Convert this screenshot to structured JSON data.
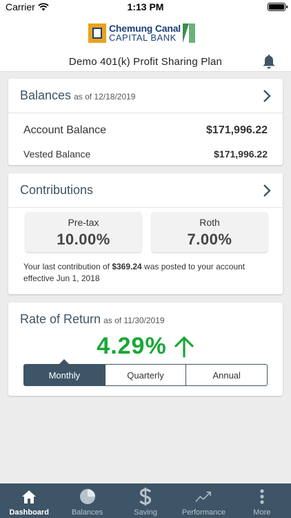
{
  "status": {
    "carrier": "Carrier",
    "time": "1:13 PM"
  },
  "header": {
    "logo_line1": "Chemung Canal",
    "logo_line2": "CAPITAL BANK",
    "plan_title": "Demo 401(k) Profit Sharing Plan"
  },
  "balances": {
    "title": "Balances",
    "as_of": "as of 12/18/2019",
    "account_label": "Account Balance",
    "account_value": "$171,996.22",
    "vested_label": "Vested Balance",
    "vested_value": "$171,996.22"
  },
  "contributions": {
    "title": "Contributions",
    "pretax_label": "Pre-tax",
    "pretax_value": "10.00%",
    "roth_label": "Roth",
    "roth_value": "7.00%",
    "note_prefix": "Your last contribution of ",
    "note_amount": "$369.24",
    "note_suffix": " was posted to your account effective Jun 1, 2018"
  },
  "rate_of_return": {
    "title": "Rate of Return",
    "as_of": "as of 11/30/2019",
    "value": "4.29%",
    "periods": [
      "Monthly",
      "Quarterly",
      "Annual"
    ],
    "selected": "Monthly"
  },
  "tabs": [
    {
      "label": "Dashboard",
      "icon": "home-icon",
      "active": true
    },
    {
      "label": "Balances",
      "icon": "pie-chart-icon",
      "active": false
    },
    {
      "label": "Saving",
      "icon": "dollar-icon",
      "active": false
    },
    {
      "label": "Performance",
      "icon": "trend-line-icon",
      "active": false
    },
    {
      "label": "More",
      "icon": "more-vertical-icon",
      "active": false
    }
  ],
  "colors": {
    "accent": "#3d5566",
    "positive": "#18a836",
    "background": "#ececec"
  }
}
